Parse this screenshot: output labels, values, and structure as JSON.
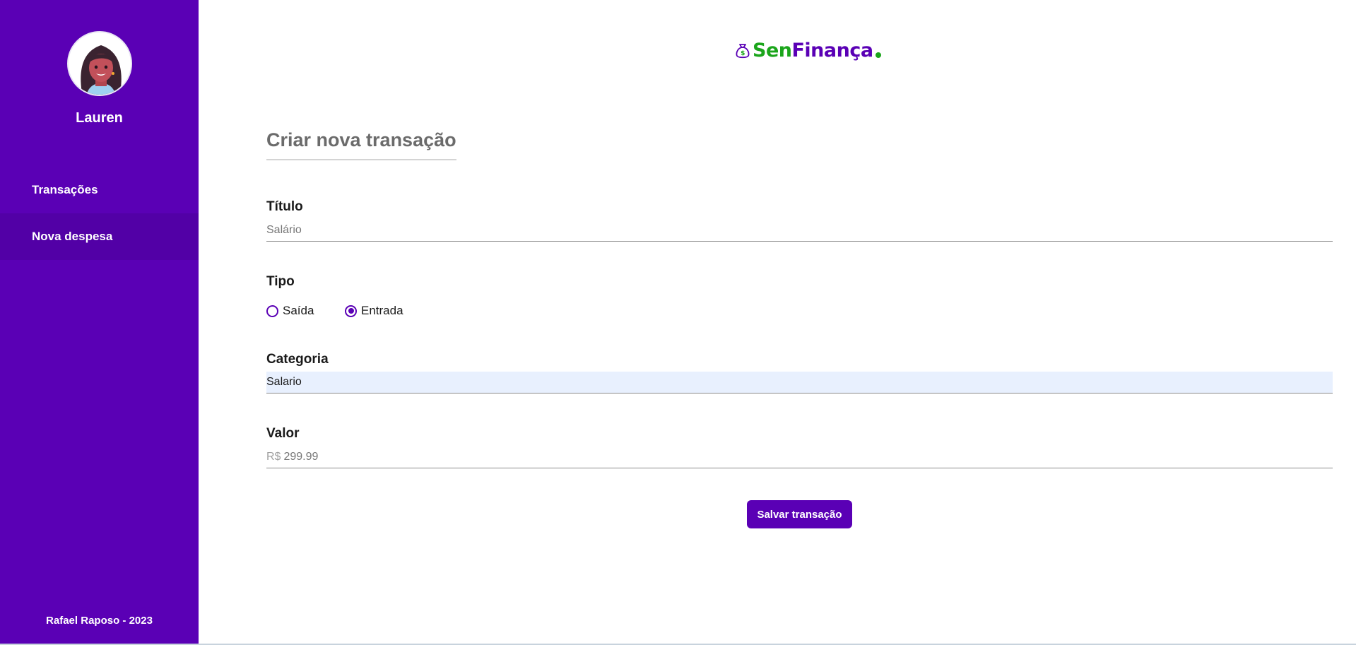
{
  "sidebar": {
    "user_name": "Lauren",
    "items": [
      {
        "label": "Transações"
      },
      {
        "label": "Nova despesa"
      }
    ],
    "footer": "Rafael Raposo - 2023"
  },
  "logo": {
    "part1": "Sen",
    "part2": "Finança",
    "icon": "money-bag-icon"
  },
  "form": {
    "title": "Criar nova transação",
    "titulo_label": "Título",
    "titulo_placeholder": "Salário",
    "tipo_label": "Tipo",
    "tipo_options": [
      {
        "label": "Saída",
        "checked": false
      },
      {
        "label": "Entrada",
        "checked": true
      }
    ],
    "categoria_label": "Categoria",
    "categoria_value": "Salario",
    "valor_label": "Valor",
    "valor_currency": "R$",
    "valor_placeholder": "299.99",
    "save_label": "Salvar transação"
  },
  "colors": {
    "primary": "#5a00b5",
    "accent_green": "#1ba51b"
  }
}
